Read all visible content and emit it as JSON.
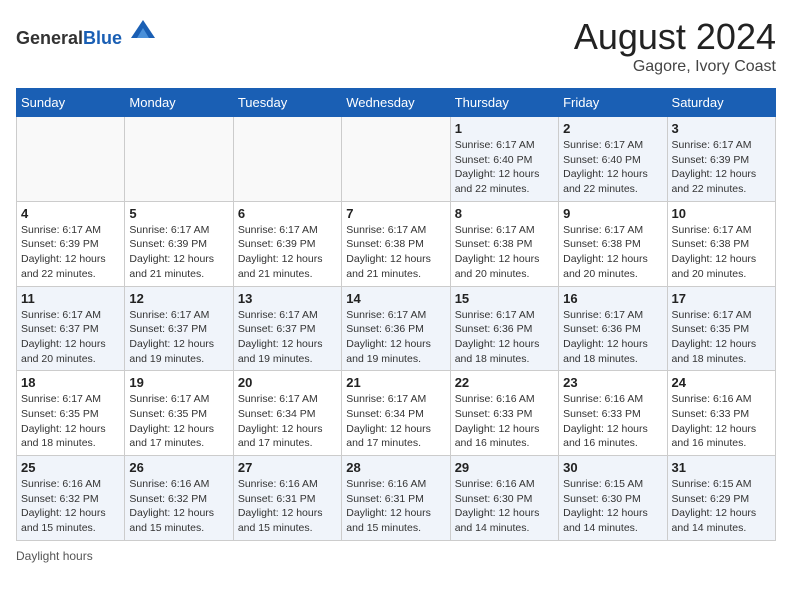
{
  "header": {
    "logo_general": "General",
    "logo_blue": "Blue",
    "month_year": "August 2024",
    "location": "Gagore, Ivory Coast"
  },
  "days_of_week": [
    "Sunday",
    "Monday",
    "Tuesday",
    "Wednesday",
    "Thursday",
    "Friday",
    "Saturday"
  ],
  "weeks": [
    [
      {
        "day": "",
        "info": ""
      },
      {
        "day": "",
        "info": ""
      },
      {
        "day": "",
        "info": ""
      },
      {
        "day": "",
        "info": ""
      },
      {
        "day": "1",
        "info": "Sunrise: 6:17 AM\nSunset: 6:40 PM\nDaylight: 12 hours\nand 22 minutes."
      },
      {
        "day": "2",
        "info": "Sunrise: 6:17 AM\nSunset: 6:40 PM\nDaylight: 12 hours\nand 22 minutes."
      },
      {
        "day": "3",
        "info": "Sunrise: 6:17 AM\nSunset: 6:39 PM\nDaylight: 12 hours\nand 22 minutes."
      }
    ],
    [
      {
        "day": "4",
        "info": "Sunrise: 6:17 AM\nSunset: 6:39 PM\nDaylight: 12 hours\nand 22 minutes."
      },
      {
        "day": "5",
        "info": "Sunrise: 6:17 AM\nSunset: 6:39 PM\nDaylight: 12 hours\nand 21 minutes."
      },
      {
        "day": "6",
        "info": "Sunrise: 6:17 AM\nSunset: 6:39 PM\nDaylight: 12 hours\nand 21 minutes."
      },
      {
        "day": "7",
        "info": "Sunrise: 6:17 AM\nSunset: 6:38 PM\nDaylight: 12 hours\nand 21 minutes."
      },
      {
        "day": "8",
        "info": "Sunrise: 6:17 AM\nSunset: 6:38 PM\nDaylight: 12 hours\nand 20 minutes."
      },
      {
        "day": "9",
        "info": "Sunrise: 6:17 AM\nSunset: 6:38 PM\nDaylight: 12 hours\nand 20 minutes."
      },
      {
        "day": "10",
        "info": "Sunrise: 6:17 AM\nSunset: 6:38 PM\nDaylight: 12 hours\nand 20 minutes."
      }
    ],
    [
      {
        "day": "11",
        "info": "Sunrise: 6:17 AM\nSunset: 6:37 PM\nDaylight: 12 hours\nand 20 minutes."
      },
      {
        "day": "12",
        "info": "Sunrise: 6:17 AM\nSunset: 6:37 PM\nDaylight: 12 hours\nand 19 minutes."
      },
      {
        "day": "13",
        "info": "Sunrise: 6:17 AM\nSunset: 6:37 PM\nDaylight: 12 hours\nand 19 minutes."
      },
      {
        "day": "14",
        "info": "Sunrise: 6:17 AM\nSunset: 6:36 PM\nDaylight: 12 hours\nand 19 minutes."
      },
      {
        "day": "15",
        "info": "Sunrise: 6:17 AM\nSunset: 6:36 PM\nDaylight: 12 hours\nand 18 minutes."
      },
      {
        "day": "16",
        "info": "Sunrise: 6:17 AM\nSunset: 6:36 PM\nDaylight: 12 hours\nand 18 minutes."
      },
      {
        "day": "17",
        "info": "Sunrise: 6:17 AM\nSunset: 6:35 PM\nDaylight: 12 hours\nand 18 minutes."
      }
    ],
    [
      {
        "day": "18",
        "info": "Sunrise: 6:17 AM\nSunset: 6:35 PM\nDaylight: 12 hours\nand 18 minutes."
      },
      {
        "day": "19",
        "info": "Sunrise: 6:17 AM\nSunset: 6:35 PM\nDaylight: 12 hours\nand 17 minutes."
      },
      {
        "day": "20",
        "info": "Sunrise: 6:17 AM\nSunset: 6:34 PM\nDaylight: 12 hours\nand 17 minutes."
      },
      {
        "day": "21",
        "info": "Sunrise: 6:17 AM\nSunset: 6:34 PM\nDaylight: 12 hours\nand 17 minutes."
      },
      {
        "day": "22",
        "info": "Sunrise: 6:16 AM\nSunset: 6:33 PM\nDaylight: 12 hours\nand 16 minutes."
      },
      {
        "day": "23",
        "info": "Sunrise: 6:16 AM\nSunset: 6:33 PM\nDaylight: 12 hours\nand 16 minutes."
      },
      {
        "day": "24",
        "info": "Sunrise: 6:16 AM\nSunset: 6:33 PM\nDaylight: 12 hours\nand 16 minutes."
      }
    ],
    [
      {
        "day": "25",
        "info": "Sunrise: 6:16 AM\nSunset: 6:32 PM\nDaylight: 12 hours\nand 15 minutes."
      },
      {
        "day": "26",
        "info": "Sunrise: 6:16 AM\nSunset: 6:32 PM\nDaylight: 12 hours\nand 15 minutes."
      },
      {
        "day": "27",
        "info": "Sunrise: 6:16 AM\nSunset: 6:31 PM\nDaylight: 12 hours\nand 15 minutes."
      },
      {
        "day": "28",
        "info": "Sunrise: 6:16 AM\nSunset: 6:31 PM\nDaylight: 12 hours\nand 15 minutes."
      },
      {
        "day": "29",
        "info": "Sunrise: 6:16 AM\nSunset: 6:30 PM\nDaylight: 12 hours\nand 14 minutes."
      },
      {
        "day": "30",
        "info": "Sunrise: 6:15 AM\nSunset: 6:30 PM\nDaylight: 12 hours\nand 14 minutes."
      },
      {
        "day": "31",
        "info": "Sunrise: 6:15 AM\nSunset: 6:29 PM\nDaylight: 12 hours\nand 14 minutes."
      }
    ]
  ],
  "footer": {
    "note": "Daylight hours"
  }
}
